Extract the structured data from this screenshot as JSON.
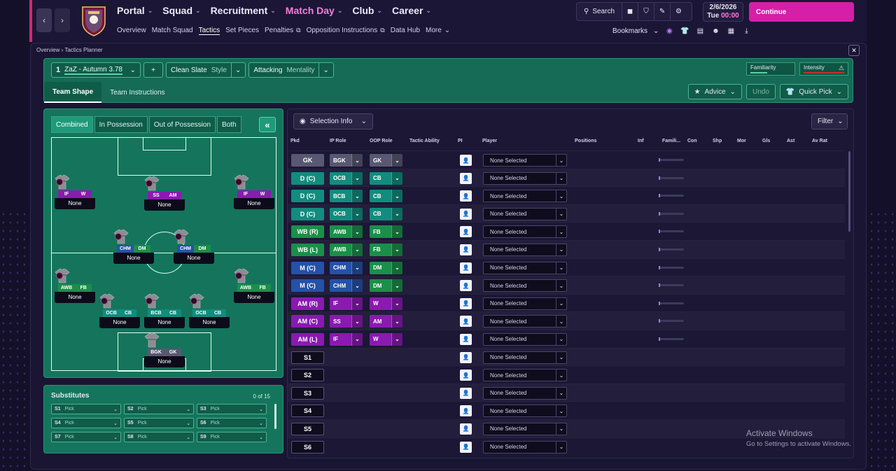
{
  "header": {
    "main_nav": [
      {
        "label": "Portal",
        "active": false
      },
      {
        "label": "Squad",
        "active": false
      },
      {
        "label": "Recruitment",
        "active": false
      },
      {
        "label": "Match Day",
        "active": true
      },
      {
        "label": "Club",
        "active": false
      },
      {
        "label": "Career",
        "active": false
      }
    ],
    "sub_nav": [
      "Overview",
      "Match Squad",
      "Tactics",
      "Set Pieces",
      "Penalties",
      "Opposition Instructions",
      "Data Hub",
      "More"
    ],
    "search_label": "Search",
    "date": "2/6/2026",
    "day": "Tue",
    "time": "00:00",
    "continue_label": "Continue",
    "bookmarks_label": "Bookmarks"
  },
  "breadcrumb": {
    "root": "Overview",
    "current": "Tactics Planner"
  },
  "tactic": {
    "slot": "1",
    "name": "ZaZ - Autumn 3.78",
    "add": "+",
    "style_value": "Clean Slate",
    "style_label": "Style",
    "mentality_value": "Attacking",
    "mentality_label": "Mentality",
    "familiarity_label": "Familiarity",
    "intensity_label": "Intensity",
    "tabs": [
      "Team Shape",
      "Team Instructions"
    ],
    "advice_label": "Advice",
    "undo_label": "Undo",
    "quickpick_label": "Quick Pick"
  },
  "pitch": {
    "tabs": [
      "Combined",
      "In Possession",
      "Out of Possession",
      "Both"
    ],
    "collapse": "«",
    "players": [
      {
        "ip": "IF",
        "oop": "W",
        "ipc": "r-purple",
        "oopc": "r-purple",
        "name": "None"
      },
      {
        "ip": "SS",
        "oop": "AM",
        "ipc": "r-purple",
        "oopc": "r-purple",
        "name": "None"
      },
      {
        "ip": "IF",
        "oop": "W",
        "ipc": "r-purple",
        "oopc": "r-purple",
        "name": "None"
      },
      {
        "ip": "CHM",
        "oop": "DM",
        "ipc": "r-blue",
        "oopc": "r-green",
        "name": "None"
      },
      {
        "ip": "CHM",
        "oop": "DM",
        "ipc": "r-blue",
        "oopc": "r-green",
        "name": "None"
      },
      {
        "ip": "AWB",
        "oop": "FB",
        "ipc": "r-green",
        "oopc": "r-green",
        "name": "None"
      },
      {
        "ip": "AWB",
        "oop": "FB",
        "ipc": "r-green",
        "oopc": "r-green",
        "name": "None"
      },
      {
        "ip": "OCB",
        "oop": "CB",
        "ipc": "r-teal",
        "oopc": "r-teal",
        "name": "None"
      },
      {
        "ip": "BCB",
        "oop": "CB",
        "ipc": "r-teal",
        "oopc": "r-teal",
        "name": "None"
      },
      {
        "ip": "OCB",
        "oop": "CB",
        "ipc": "r-teal",
        "oopc": "r-teal",
        "name": "None"
      },
      {
        "ip": "BGK",
        "oop": "GK",
        "ipc": "r-grey",
        "oopc": "r-grey",
        "name": "None"
      }
    ]
  },
  "subs": {
    "title": "Substitutes",
    "count": "0 of 15",
    "slots": [
      {
        "id": "S1",
        "label": "Pick"
      },
      {
        "id": "S2",
        "label": "Pick"
      },
      {
        "id": "S3",
        "label": "Pick"
      },
      {
        "id": "S4",
        "label": "Pick"
      },
      {
        "id": "S5",
        "label": "Pick"
      },
      {
        "id": "S6",
        "label": "Pick"
      },
      {
        "id": "S7",
        "label": "Pick"
      },
      {
        "id": "S8",
        "label": "Pick"
      },
      {
        "id": "S9",
        "label": "Pick"
      }
    ]
  },
  "table": {
    "selection_info": "Selection Info",
    "filter": "Filter",
    "columns": [
      "Pkd",
      "IP Role",
      "OOP Role",
      "Tactic Ability",
      "PI",
      "Player",
      "Positions",
      "Inf",
      "Famili...",
      "Con",
      "Shp",
      "Mor",
      "Gls",
      "Ast",
      "Av Rat"
    ],
    "rows": [
      {
        "pos": "GK",
        "ip": "BGK",
        "oop": "GK",
        "color": "#5a5772",
        "ipc": "#5a5772",
        "oopc": "#5a5772",
        "player": "None Selected",
        "fam": true
      },
      {
        "pos": "D (C)",
        "ip": "OCB",
        "oop": "CB",
        "color": "#128c7e",
        "ipc": "#128c7e",
        "oopc": "#128c7e",
        "player": "None Selected",
        "fam": true
      },
      {
        "pos": "D (C)",
        "ip": "BCB",
        "oop": "CB",
        "color": "#128c7e",
        "ipc": "#128c7e",
        "oopc": "#128c7e",
        "player": "None Selected",
        "fam": true
      },
      {
        "pos": "D (C)",
        "ip": "OCB",
        "oop": "CB",
        "color": "#128c7e",
        "ipc": "#128c7e",
        "oopc": "#128c7e",
        "player": "None Selected",
        "fam": true
      },
      {
        "pos": "WB (R)",
        "ip": "AWB",
        "oop": "FB",
        "color": "#1b8f4a",
        "ipc": "#1b8f4a",
        "oopc": "#1b8f4a",
        "player": "None Selected",
        "fam": true
      },
      {
        "pos": "WB (L)",
        "ip": "AWB",
        "oop": "FB",
        "color": "#1b8f4a",
        "ipc": "#1b8f4a",
        "oopc": "#1b8f4a",
        "player": "None Selected",
        "fam": true
      },
      {
        "pos": "M (C)",
        "ip": "CHM",
        "oop": "DM",
        "color": "#2452a8",
        "ipc": "#2452a8",
        "oopc": "#1b8f4a",
        "player": "None Selected",
        "fam": true
      },
      {
        "pos": "M (C)",
        "ip": "CHM",
        "oop": "DM",
        "color": "#2452a8",
        "ipc": "#2452a8",
        "oopc": "#1b8f4a",
        "player": "None Selected",
        "fam": true
      },
      {
        "pos": "AM (R)",
        "ip": "IF",
        "oop": "W",
        "color": "#8a1ab0",
        "ipc": "#8a1ab0",
        "oopc": "#8a1ab0",
        "player": "None Selected",
        "fam": true
      },
      {
        "pos": "AM (C)",
        "ip": "SS",
        "oop": "AM",
        "color": "#8a1ab0",
        "ipc": "#8a1ab0",
        "oopc": "#8a1ab0",
        "player": "None Selected",
        "fam": true
      },
      {
        "pos": "AM (L)",
        "ip": "IF",
        "oop": "W",
        "color": "#8a1ab0",
        "ipc": "#8a1ab0",
        "oopc": "#8a1ab0",
        "player": "None Selected",
        "fam": true
      },
      {
        "pos": "S1",
        "slot": true,
        "player": "None Selected"
      },
      {
        "pos": "S2",
        "slot": true,
        "player": "None Selected"
      },
      {
        "pos": "S3",
        "slot": true,
        "player": "None Selected"
      },
      {
        "pos": "S4",
        "slot": true,
        "player": "None Selected"
      },
      {
        "pos": "S5",
        "slot": true,
        "player": "None Selected"
      },
      {
        "pos": "S6",
        "slot": true,
        "player": "None Selected"
      }
    ]
  },
  "watermark": {
    "line1": "Activate Windows",
    "line2": "Go to Settings to activate Windows."
  }
}
